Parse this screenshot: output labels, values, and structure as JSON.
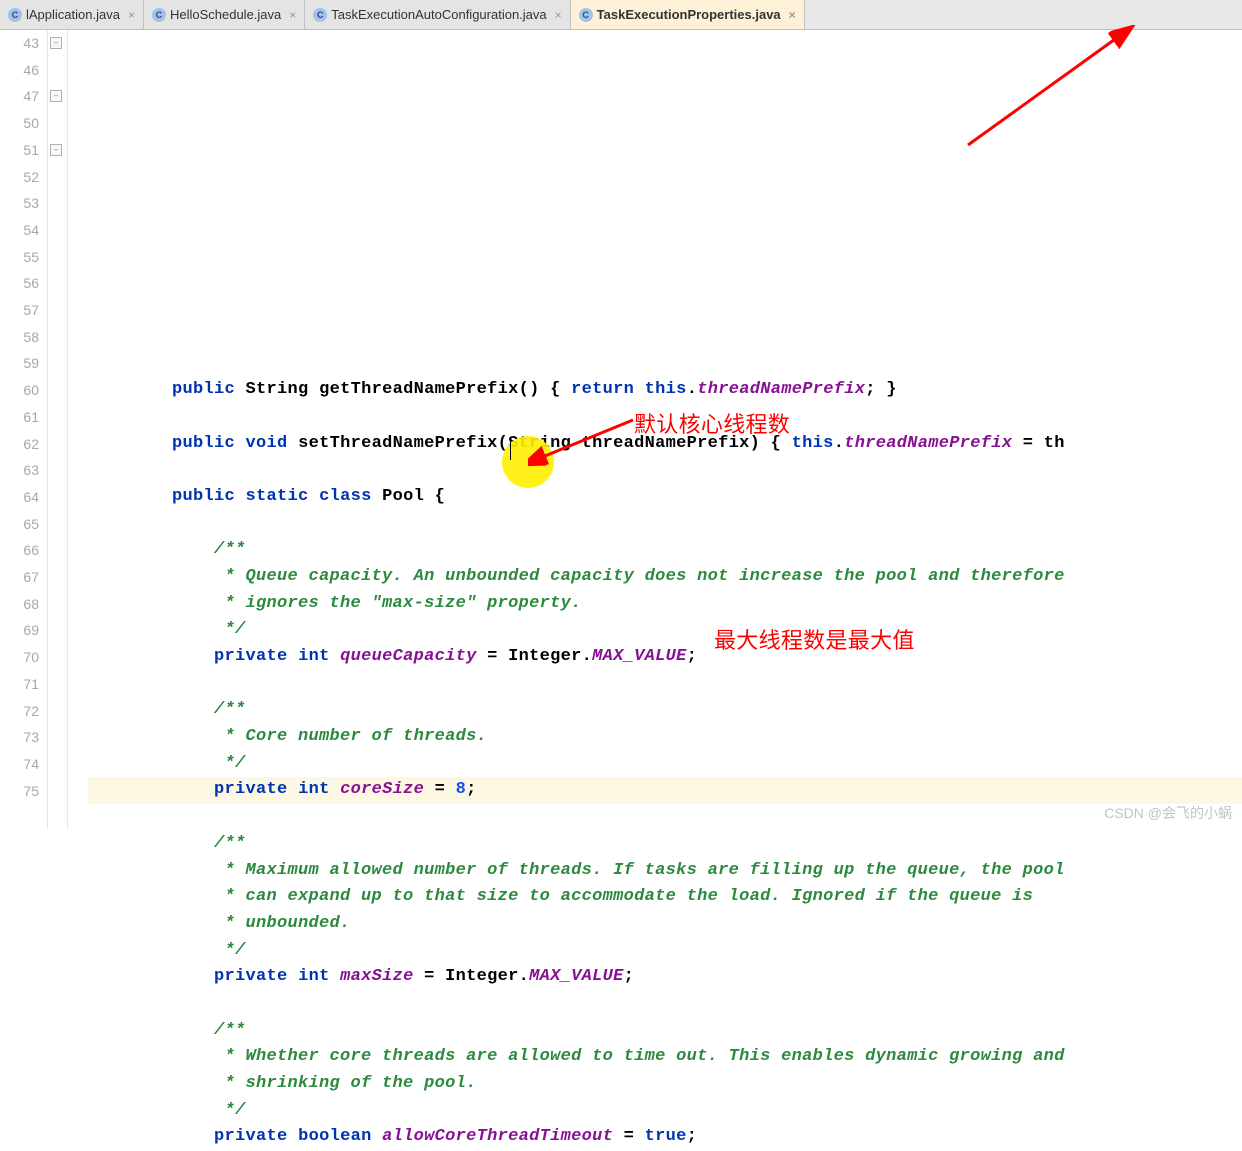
{
  "tabs": [
    {
      "label": "lApplication.java",
      "active": false
    },
    {
      "label": "HelloSchedule.java",
      "active": false
    },
    {
      "label": "TaskExecutionAutoConfiguration.java",
      "active": false
    },
    {
      "label": "TaskExecutionProperties.java",
      "active": true
    }
  ],
  "file_icon_letter": "C",
  "close_glyph": "×",
  "line_start": 43,
  "line_end": 75,
  "gutter_lines": [
    "43",
    "46",
    "47",
    "50",
    "51",
    "52",
    "53",
    "54",
    "55",
    "56",
    "57",
    "58",
    "59",
    "60",
    "61",
    "62",
    "63",
    "64",
    "65",
    "66",
    "67",
    "68",
    "69",
    "70",
    "71",
    "72",
    "73",
    "74",
    "75"
  ],
  "lines": [
    {
      "n": 43,
      "indent": 2,
      "tokens": [
        [
          "kw",
          "public"
        ],
        [
          "p",
          " "
        ],
        [
          "type",
          "String"
        ],
        [
          "p",
          " "
        ],
        [
          "mth",
          "getThreadNamePrefix"
        ],
        [
          "p",
          "() { "
        ],
        [
          "kw",
          "return"
        ],
        [
          "p",
          " "
        ],
        [
          "thi",
          "this"
        ],
        [
          "p",
          "."
        ],
        [
          "fld",
          "threadNamePrefix"
        ],
        [
          "p",
          "; }"
        ]
      ]
    },
    {
      "n": 46,
      "indent": 0,
      "tokens": []
    },
    {
      "n": 47,
      "indent": 2,
      "tokens": [
        [
          "kw",
          "public"
        ],
        [
          "p",
          " "
        ],
        [
          "kw",
          "void"
        ],
        [
          "p",
          " "
        ],
        [
          "mth",
          "setThreadNamePrefix"
        ],
        [
          "p",
          "(String threadNamePrefix) { "
        ],
        [
          "thi",
          "this"
        ],
        [
          "p",
          "."
        ],
        [
          "fld",
          "threadNamePrefix"
        ],
        [
          "p",
          " = th"
        ]
      ]
    },
    {
      "n": 50,
      "indent": 0,
      "tokens": []
    },
    {
      "n": 51,
      "indent": 2,
      "tokens": [
        [
          "kw",
          "public"
        ],
        [
          "p",
          " "
        ],
        [
          "kw",
          "static"
        ],
        [
          "p",
          " "
        ],
        [
          "kw",
          "class"
        ],
        [
          "p",
          " "
        ],
        [
          "cls",
          "Pool"
        ],
        [
          "p",
          " {"
        ]
      ]
    },
    {
      "n": 52,
      "indent": 0,
      "tokens": []
    },
    {
      "n": 53,
      "indent": 3,
      "tokens": [
        [
          "cmt",
          "/**"
        ]
      ]
    },
    {
      "n": 54,
      "indent": 3,
      "tokens": [
        [
          "cmt",
          " * Queue capacity. An unbounded capacity does not increase the pool and therefore"
        ]
      ]
    },
    {
      "n": 55,
      "indent": 3,
      "tokens": [
        [
          "cmt",
          " * ignores the \"max-size\" property."
        ]
      ]
    },
    {
      "n": 56,
      "indent": 3,
      "tokens": [
        [
          "cmt",
          " */"
        ]
      ]
    },
    {
      "n": 57,
      "indent": 3,
      "tokens": [
        [
          "kw",
          "private"
        ],
        [
          "p",
          " "
        ],
        [
          "kw",
          "int"
        ],
        [
          "p",
          " "
        ],
        [
          "fld",
          "queueCapacity"
        ],
        [
          "p",
          " = Integer."
        ],
        [
          "sfld",
          "MAX_VALUE"
        ],
        [
          "p",
          ";"
        ]
      ]
    },
    {
      "n": 58,
      "indent": 0,
      "tokens": []
    },
    {
      "n": 59,
      "indent": 3,
      "tokens": [
        [
          "cmt",
          "/**"
        ]
      ]
    },
    {
      "n": 60,
      "indent": 3,
      "tokens": [
        [
          "cmt",
          " * Core number of threads."
        ]
      ]
    },
    {
      "n": 61,
      "indent": 3,
      "tokens": [
        [
          "cmt",
          " */"
        ]
      ]
    },
    {
      "n": 62,
      "indent": 3,
      "hl": true,
      "tokens": [
        [
          "kw",
          "private"
        ],
        [
          "p",
          " "
        ],
        [
          "kw",
          "int"
        ],
        [
          "p",
          " "
        ],
        [
          "fld",
          "coreSize"
        ],
        [
          "p",
          " = "
        ],
        [
          "num",
          "8"
        ],
        [
          "p",
          ";"
        ]
      ]
    },
    {
      "n": 63,
      "indent": 0,
      "tokens": []
    },
    {
      "n": 64,
      "indent": 3,
      "tokens": [
        [
          "cmt",
          "/**"
        ]
      ]
    },
    {
      "n": 65,
      "indent": 3,
      "tokens": [
        [
          "cmt",
          " * Maximum allowed number of threads. If tasks are filling up the queue, the pool"
        ]
      ]
    },
    {
      "n": 66,
      "indent": 3,
      "tokens": [
        [
          "cmt",
          " * can expand up to that size to accommodate the load. Ignored if the queue is"
        ]
      ]
    },
    {
      "n": 67,
      "indent": 3,
      "tokens": [
        [
          "cmt",
          " * unbounded."
        ]
      ]
    },
    {
      "n": 68,
      "indent": 3,
      "tokens": [
        [
          "cmt",
          " */"
        ]
      ]
    },
    {
      "n": 69,
      "indent": 3,
      "tokens": [
        [
          "kw",
          "private"
        ],
        [
          "p",
          " "
        ],
        [
          "kw",
          "int"
        ],
        [
          "p",
          " "
        ],
        [
          "fld",
          "maxSize"
        ],
        [
          "p",
          " = Integer."
        ],
        [
          "sfld",
          "MAX_VALUE"
        ],
        [
          "p",
          ";"
        ]
      ]
    },
    {
      "n": 70,
      "indent": 0,
      "tokens": []
    },
    {
      "n": 71,
      "indent": 3,
      "tokens": [
        [
          "cmt",
          "/**"
        ]
      ]
    },
    {
      "n": 72,
      "indent": 3,
      "tokens": [
        [
          "cmt",
          " * Whether core threads are allowed to time out. This enables dynamic growing and"
        ]
      ]
    },
    {
      "n": 73,
      "indent": 3,
      "tokens": [
        [
          "cmt",
          " * shrinking of the pool."
        ]
      ]
    },
    {
      "n": 74,
      "indent": 3,
      "tokens": [
        [
          "cmt",
          " */"
        ]
      ]
    },
    {
      "n": 75,
      "indent": 3,
      "tokens": [
        [
          "kw",
          "private"
        ],
        [
          "p",
          " "
        ],
        [
          "kw",
          "boolean"
        ],
        [
          "p",
          " "
        ],
        [
          "fld",
          "allowCoreThreadTimeout"
        ],
        [
          "p",
          " = "
        ],
        [
          "kw",
          "true"
        ],
        [
          "p",
          ";"
        ]
      ]
    }
  ],
  "annotations": {
    "core_threads": "默认核心线程数",
    "max_threads": "最大线程数是最大值"
  },
  "watermark": "CSDN @会飞的小蜗"
}
